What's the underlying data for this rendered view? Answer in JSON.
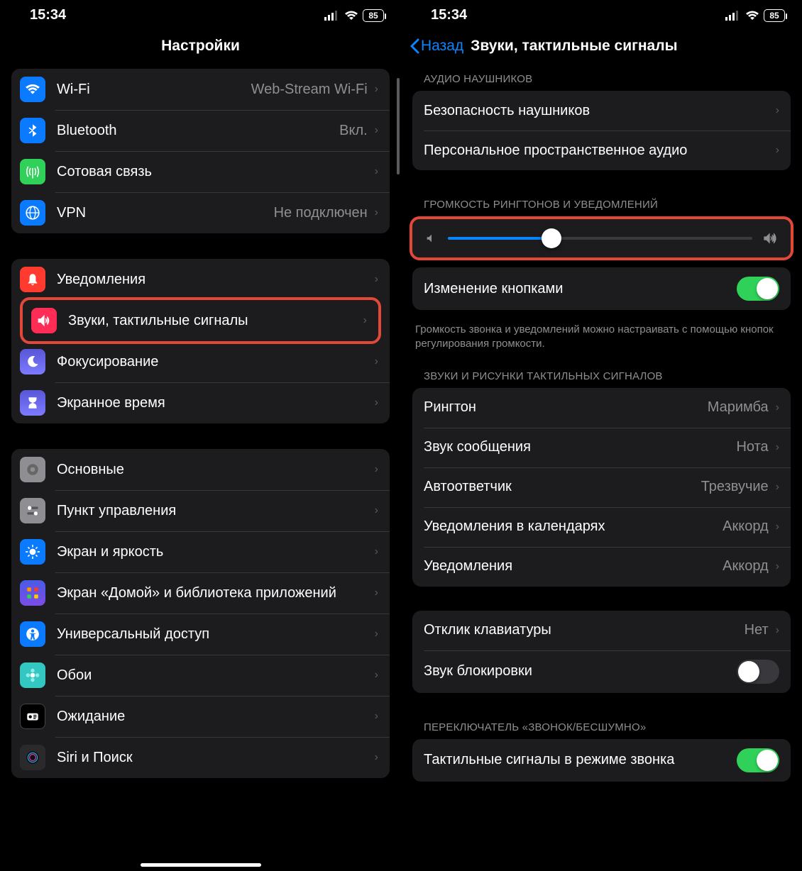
{
  "status": {
    "time": "15:34",
    "battery": "85"
  },
  "left": {
    "title": "Настройки",
    "groups": [
      {
        "rows": [
          {
            "key": "wifi",
            "label": "Wi-Fi",
            "value": "Web-Stream Wi-Fi",
            "icon": "wifi-icon",
            "color": "#0a7aff"
          },
          {
            "key": "bluetooth",
            "label": "Bluetooth",
            "value": "Вкл.",
            "icon": "bluetooth-icon",
            "color": "#0a7aff"
          },
          {
            "key": "cellular",
            "label": "Сотовая связь",
            "value": "",
            "icon": "antenna-icon",
            "color": "#30d158"
          },
          {
            "key": "vpn",
            "label": "VPN",
            "value": "Не подключен",
            "icon": "globe-icon",
            "color": "#0a7aff"
          }
        ]
      },
      {
        "rows": [
          {
            "key": "notifications",
            "label": "Уведомления",
            "value": "",
            "icon": "bell-icon",
            "color": "#ff3b30"
          },
          {
            "key": "sounds",
            "label": "Звуки, тактильные сигналы",
            "value": "",
            "icon": "speaker-icon",
            "color": "#ff2d55",
            "highlight": true
          },
          {
            "key": "focus",
            "label": "Фокусирование",
            "value": "",
            "icon": "moon-icon",
            "color": "#5856d6"
          },
          {
            "key": "screentime",
            "label": "Экранное время",
            "value": "",
            "icon": "hourglass-icon",
            "color": "#5856d6"
          }
        ]
      },
      {
        "rows": [
          {
            "key": "general",
            "label": "Основные",
            "value": "",
            "icon": "gear-icon",
            "color": "#8e8e93"
          },
          {
            "key": "control",
            "label": "Пункт управления",
            "value": "",
            "icon": "switches-icon",
            "color": "#8e8e93"
          },
          {
            "key": "display",
            "label": "Экран и яркость",
            "value": "",
            "icon": "sun-icon",
            "color": "#0a7aff"
          },
          {
            "key": "home",
            "label": "Экран «Домой» и библиотека приложений",
            "value": "",
            "icon": "grid-icon",
            "color": "#3440d4"
          },
          {
            "key": "accessibility",
            "label": "Универсальный доступ",
            "value": "",
            "icon": "person-icon",
            "color": "#0a7aff"
          },
          {
            "key": "wallpaper",
            "label": "Обои",
            "value": "",
            "icon": "flower-icon",
            "color": "#34c7c1"
          },
          {
            "key": "standby",
            "label": "Ожидание",
            "value": "",
            "icon": "clock-icon",
            "color": "#000",
            "border": true
          },
          {
            "key": "siri",
            "label": "Siri и Поиск",
            "value": "",
            "icon": "siri-icon",
            "color": "#2a2a2c"
          }
        ]
      }
    ]
  },
  "right": {
    "back": "Назад",
    "title": "Звуки, тактильные сигналы",
    "sections": {
      "headphones_header": "АУДИО НАУШНИКОВ",
      "headphone_safety": "Безопасность наушников",
      "spatial_audio": "Персональное пространственное аудио",
      "volume_header": "ГРОМКОСТЬ РИНГТОНОВ И УВЕДОМЛЕНИЙ",
      "slider_value": 34,
      "change_buttons": "Изменение кнопками",
      "change_buttons_on": true,
      "footer_note": "Громкость звонка и уведомлений можно настраивать с помощью кнопок регулирования громкости.",
      "patterns_header": "ЗВУКИ И РИСУНКИ ТАКТИЛЬНЫХ СИГНАЛОВ",
      "sounds": [
        {
          "label": "Рингтон",
          "value": "Маримба"
        },
        {
          "label": "Звук сообщения",
          "value": "Нота"
        },
        {
          "label": "Автоответчик",
          "value": "Трезвучие"
        },
        {
          "label": "Уведомления в календарях",
          "value": "Аккорд"
        },
        {
          "label": "Уведомления",
          "value": "Аккорд"
        }
      ],
      "keyboard_feedback": "Отклик клавиатуры",
      "keyboard_value": "Нет",
      "lock_sound": "Звук блокировки",
      "lock_sound_on": false,
      "ring_silent_header": "ПЕРЕКЛЮЧАТЕЛЬ «ЗВОНОК/БЕСШУМНО»",
      "haptics_ring": "Тактильные сигналы в режиме звонка",
      "haptics_ring_on": true
    }
  }
}
